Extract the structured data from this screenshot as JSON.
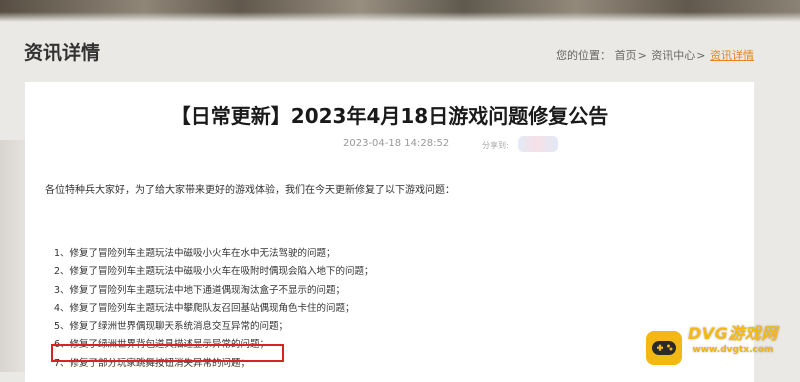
{
  "header": {
    "page_title": "资讯详情",
    "breadcrumb": {
      "prefix": "您的位置：",
      "items": [
        "首页",
        "资讯中心",
        "资讯详情"
      ],
      "separator": ">"
    }
  },
  "article": {
    "title": "【日常更新】2023年4月18日游戏问题修复公告",
    "date": "2023-04-18 14:28:52",
    "share_label": "分享到:",
    "intro": "各位特种兵大家好，为了给大家带来更好的游戏体验，我们在今天更新修复了以下游戏问题：",
    "fixes": [
      "1、修复了冒险列车主题玩法中磁吸小火车在水中无法驾驶的问题；",
      "2、修复了冒险列车主题玩法中磁吸小火车在吸附时偶现会陷入地下的问题；",
      "3、修复了冒险列车主题玩法中地下通道偶现淘汰盒子不显示的问题；",
      "4、修复了冒险列车主题玩法中攀爬队友召回基站偶现角色卡住的问题；",
      "5、修复了绿洲世界偶现聊天系统消息交互异常的问题；",
      "6、修复了绿洲世界背包道具描述显示异常的问题；",
      "7、修复了部分玩家跳舞按钮消失异常的问题；"
    ],
    "highlighted_index": 6
  },
  "watermark": {
    "brand": "DVG游戏网",
    "url": "www.dvgtx.com",
    "icon": "gamepad-icon",
    "color": "#f3b814"
  },
  "colors": {
    "accent": "#e6851c",
    "highlight_border": "#d62424"
  }
}
